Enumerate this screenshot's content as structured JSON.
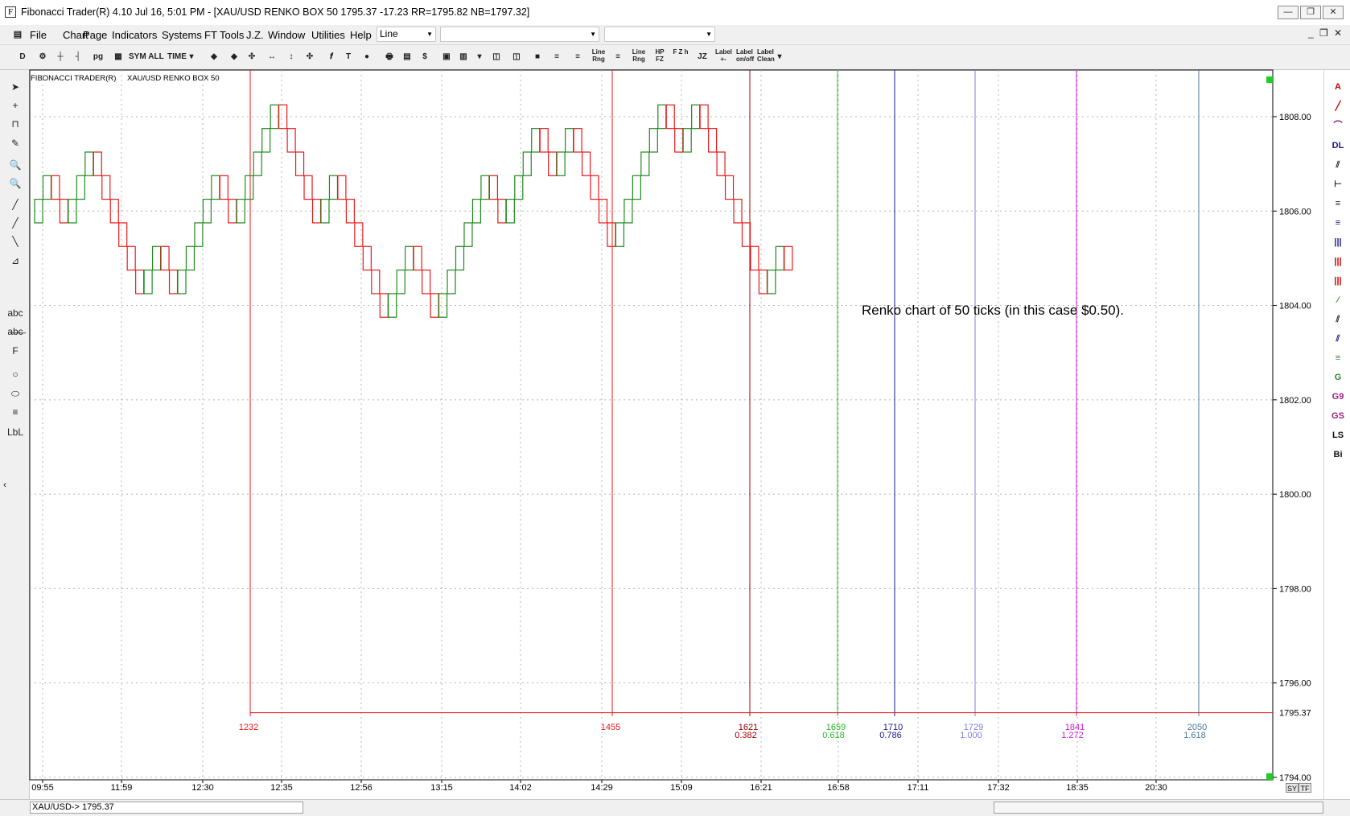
{
  "window": {
    "title": "Fibonacci Trader(R) 4.10 Jul 16,  5:01 PM - [XAU/USD RENKO BOX 50 1795.37   -17.23 RR=1795.82 NB=1797.32]",
    "minimize_glyph": "—",
    "maximize_glyph": "❐",
    "close_glyph": "✕",
    "app_icon": "F"
  },
  "menu": {
    "items": [
      "File",
      "Chart",
      "Page",
      "Indicators",
      "Systems",
      "FT Tools",
      "J.Z.",
      "Window",
      "Utilities",
      "Help"
    ],
    "combo1": "Line",
    "combo2": "",
    "combo3": "",
    "mdi_min": "_",
    "mdi_restore": "❐",
    "mdi_close": "✕"
  },
  "toolbar": {
    "buttons": [
      "D",
      "⚙",
      "┼",
      "┤",
      "pg",
      "▦",
      "SYM",
      "ALL",
      "TIME",
      "▾",
      "◆",
      "◆",
      "✣",
      "↔",
      "↕",
      "✣",
      "𝒇",
      "T",
      "●",
      "🖶",
      "▤",
      "$",
      "▣",
      "▥",
      "▾",
      "◫",
      "◫",
      "■",
      "≡",
      "≡",
      "Line Rng",
      "≡",
      "Line Rng",
      "HP FZ",
      "F Z h",
      "JZ",
      "Label +-",
      "Label on/off",
      "Label Clean",
      "▾"
    ]
  },
  "left_tools": {
    "icons": [
      "arrow-icon",
      "crosshair-icon",
      "magnet-icon",
      "pencil-icon",
      "zoom-in-icon",
      "zoom-out-icon",
      "trendline-green-icon",
      "trendline-blue-icon",
      "trendline-navy-icon",
      "ruler-icon",
      "text-icon",
      "erase-text-icon",
      "fib-f-icon",
      "circle-icon",
      "ellipse-icon",
      "color-lines-icon",
      "label-icon"
    ],
    "glyphs": [
      "➤",
      "+",
      "⊓",
      "✎",
      "🔍",
      "🔍",
      "╱",
      "╱",
      "╲",
      "⊿",
      "abc",
      "a̶b̶c̶",
      "F",
      "○",
      "⬭",
      "≡",
      "LbL"
    ],
    "collapse": "‹"
  },
  "right_tools": {
    "glyphs": [
      "A",
      "╱",
      "⌒",
      "DL",
      "⫽",
      "⊢",
      "≡",
      "≡",
      "|||",
      "|||",
      "|||",
      "⁄",
      "⫽",
      "⫽",
      "≡",
      "G",
      "G9",
      "GS",
      "LS",
      "Bi"
    ],
    "colors": [
      "#c00000",
      "#c00000",
      "#800080",
      "#1a1a8a",
      "#222222",
      "#222222",
      "#222222",
      "#1a1a8a",
      "#1a1a8a",
      "#c00000",
      "#c00000",
      "#2a8a2a",
      "#222222",
      "#1a1a8a",
      "#2a8a2a",
      "#2a8a2a",
      "#a02080",
      "#a02080",
      "#111111",
      "#111111"
    ]
  },
  "status": {
    "left_text": "XAU/USD->  1795.37",
    "sy": "SY",
    "tf": "TF"
  },
  "chart_data": {
    "type": "renko",
    "header_left": "FIBONACCI TRADER(R)",
    "header_symbol": "XAU/USD RENKO BOX 50",
    "annotation": "Renko chart of 50 ticks (in this case $0.50).",
    "box_size": 0.5,
    "ylim": [
      1794.0,
      1809.8
    ],
    "yticks": [
      1808.0,
      1806.0,
      1804.0,
      1802.0,
      1800.0,
      1798.0,
      1796.0,
      1794.0
    ],
    "ytick_labels": [
      "1808.00",
      "1806.00",
      "1804.00",
      "1802.00",
      "1800.00",
      "1798.00",
      "1796.00",
      "1794.00"
    ],
    "last_price": 1795.37,
    "last_price_label": "1795.37",
    "start_price": 1805.75,
    "brick_count": 90,
    "bricks": [
      {
        "d": 1,
        "level": 1806.25
      },
      {
        "d": 1,
        "level": 1806.75
      },
      {
        "d": -1,
        "level": 1806.25
      },
      {
        "d": -1,
        "level": 1805.75
      },
      {
        "d": 1,
        "level": 1806.25
      },
      {
        "d": 1,
        "level": 1806.75
      },
      {
        "d": 1,
        "level": 1807.25
      },
      {
        "d": -1,
        "level": 1806.75
      },
      {
        "d": -1,
        "level": 1806.25
      },
      {
        "d": -1,
        "level": 1805.75
      },
      {
        "d": -1,
        "level": 1805.25
      },
      {
        "d": -1,
        "level": 1804.75
      },
      {
        "d": -1,
        "level": 1804.25
      },
      {
        "d": 1,
        "level": 1804.75
      },
      {
        "d": 1,
        "level": 1805.25
      },
      {
        "d": -1,
        "level": 1804.75
      },
      {
        "d": -1,
        "level": 1804.25
      },
      {
        "d": 1,
        "level": 1804.75
      },
      {
        "d": 1,
        "level": 1805.25
      },
      {
        "d": 1,
        "level": 1805.75
      },
      {
        "d": 1,
        "level": 1806.25
      },
      {
        "d": 1,
        "level": 1806.75
      },
      {
        "d": -1,
        "level": 1806.25
      },
      {
        "d": -1,
        "level": 1805.75
      },
      {
        "d": 1,
        "level": 1806.25
      },
      {
        "d": 1,
        "level": 1806.75
      },
      {
        "d": 1,
        "level": 1807.25
      },
      {
        "d": 1,
        "level": 1807.75
      },
      {
        "d": 1,
        "level": 1808.25
      },
      {
        "d": -1,
        "level": 1807.75
      },
      {
        "d": -1,
        "level": 1807.25
      },
      {
        "d": -1,
        "level": 1806.75
      },
      {
        "d": -1,
        "level": 1806.25
      },
      {
        "d": -1,
        "level": 1805.75
      },
      {
        "d": 1,
        "level": 1806.25
      },
      {
        "d": 1,
        "level": 1806.75
      },
      {
        "d": -1,
        "level": 1806.25
      },
      {
        "d": -1,
        "level": 1805.75
      },
      {
        "d": -1,
        "level": 1805.25
      },
      {
        "d": -1,
        "level": 1804.75
      },
      {
        "d": -1,
        "level": 1804.25
      },
      {
        "d": -1,
        "level": 1803.75
      },
      {
        "d": 1,
        "level": 1804.25
      },
      {
        "d": 1,
        "level": 1804.75
      },
      {
        "d": 1,
        "level": 1805.25
      },
      {
        "d": -1,
        "level": 1804.75
      },
      {
        "d": -1,
        "level": 1804.25
      },
      {
        "d": -1,
        "level": 1803.75
      },
      {
        "d": 1,
        "level": 1804.25
      },
      {
        "d": 1,
        "level": 1804.75
      },
      {
        "d": 1,
        "level": 1805.25
      },
      {
        "d": 1,
        "level": 1805.75
      },
      {
        "d": 1,
        "level": 1806.25
      },
      {
        "d": 1,
        "level": 1806.75
      },
      {
        "d": -1,
        "level": 1806.25
      },
      {
        "d": -1,
        "level": 1805.75
      },
      {
        "d": 1,
        "level": 1806.25
      },
      {
        "d": 1,
        "level": 1806.75
      },
      {
        "d": 1,
        "level": 1807.25
      },
      {
        "d": 1,
        "level": 1807.75
      },
      {
        "d": -1,
        "level": 1807.25
      },
      {
        "d": -1,
        "level": 1806.75
      },
      {
        "d": 1,
        "level": 1807.25
      },
      {
        "d": 1,
        "level": 1807.75
      },
      {
        "d": -1,
        "level": 1807.25
      },
      {
        "d": -1,
        "level": 1806.75
      },
      {
        "d": -1,
        "level": 1806.25
      },
      {
        "d": -1,
        "level": 1805.75
      },
      {
        "d": -1,
        "level": 1805.25
      },
      {
        "d": 1,
        "level": 1805.75
      },
      {
        "d": 1,
        "level": 1806.25
      },
      {
        "d": 1,
        "level": 1806.75
      },
      {
        "d": 1,
        "level": 1807.25
      },
      {
        "d": 1,
        "level": 1807.75
      },
      {
        "d": 1,
        "level": 1808.25
      },
      {
        "d": -1,
        "level": 1807.75
      },
      {
        "d": -1,
        "level": 1807.25
      },
      {
        "d": 1,
        "level": 1807.75
      },
      {
        "d": 1,
        "level": 1808.25
      },
      {
        "d": -1,
        "level": 1807.75
      },
      {
        "d": -1,
        "level": 1807.25
      },
      {
        "d": -1,
        "level": 1806.75
      },
      {
        "d": -1,
        "level": 1806.25
      },
      {
        "d": -1,
        "level": 1805.75
      },
      {
        "d": -1,
        "level": 1805.25
      },
      {
        "d": -1,
        "level": 1804.75
      },
      {
        "d": -1,
        "level": 1804.25
      },
      {
        "d": 1,
        "level": 1804.75
      },
      {
        "d": 1,
        "level": 1805.25
      },
      {
        "d": -1,
        "level": 1804.75
      }
    ],
    "x_tick_labels": [
      "09:55",
      "11:59",
      "12:30",
      "12:35",
      "12:56",
      "13:15",
      "14:02",
      "14:29",
      "15:09",
      "16:21",
      "16:58",
      "17:11",
      "17:32",
      "18:35",
      "20:30"
    ],
    "price_line_color": "#e8191b",
    "up_color": "#1e8a1e",
    "down_color": "#e8191b",
    "time_lines": [
      {
        "label": "1232",
        "ratio": "",
        "color": "#e8191b"
      },
      {
        "label": "1455",
        "ratio": "",
        "color": "#e8191b"
      },
      {
        "label": "1621",
        "ratio": "0.382",
        "color": "#a00000"
      },
      {
        "label": "1659",
        "ratio": "0.618",
        "color": "#22bb22"
      },
      {
        "label": "1710",
        "ratio": "0.786",
        "color": "#1a1a8a"
      },
      {
        "label": "1729",
        "ratio": "1.000",
        "color": "#8080e0"
      },
      {
        "label": "1841",
        "ratio": "1.272",
        "color": "#d020d0"
      },
      {
        "label": "2050",
        "ratio": "1.618",
        "color": "#4a7a9a"
      }
    ]
  }
}
